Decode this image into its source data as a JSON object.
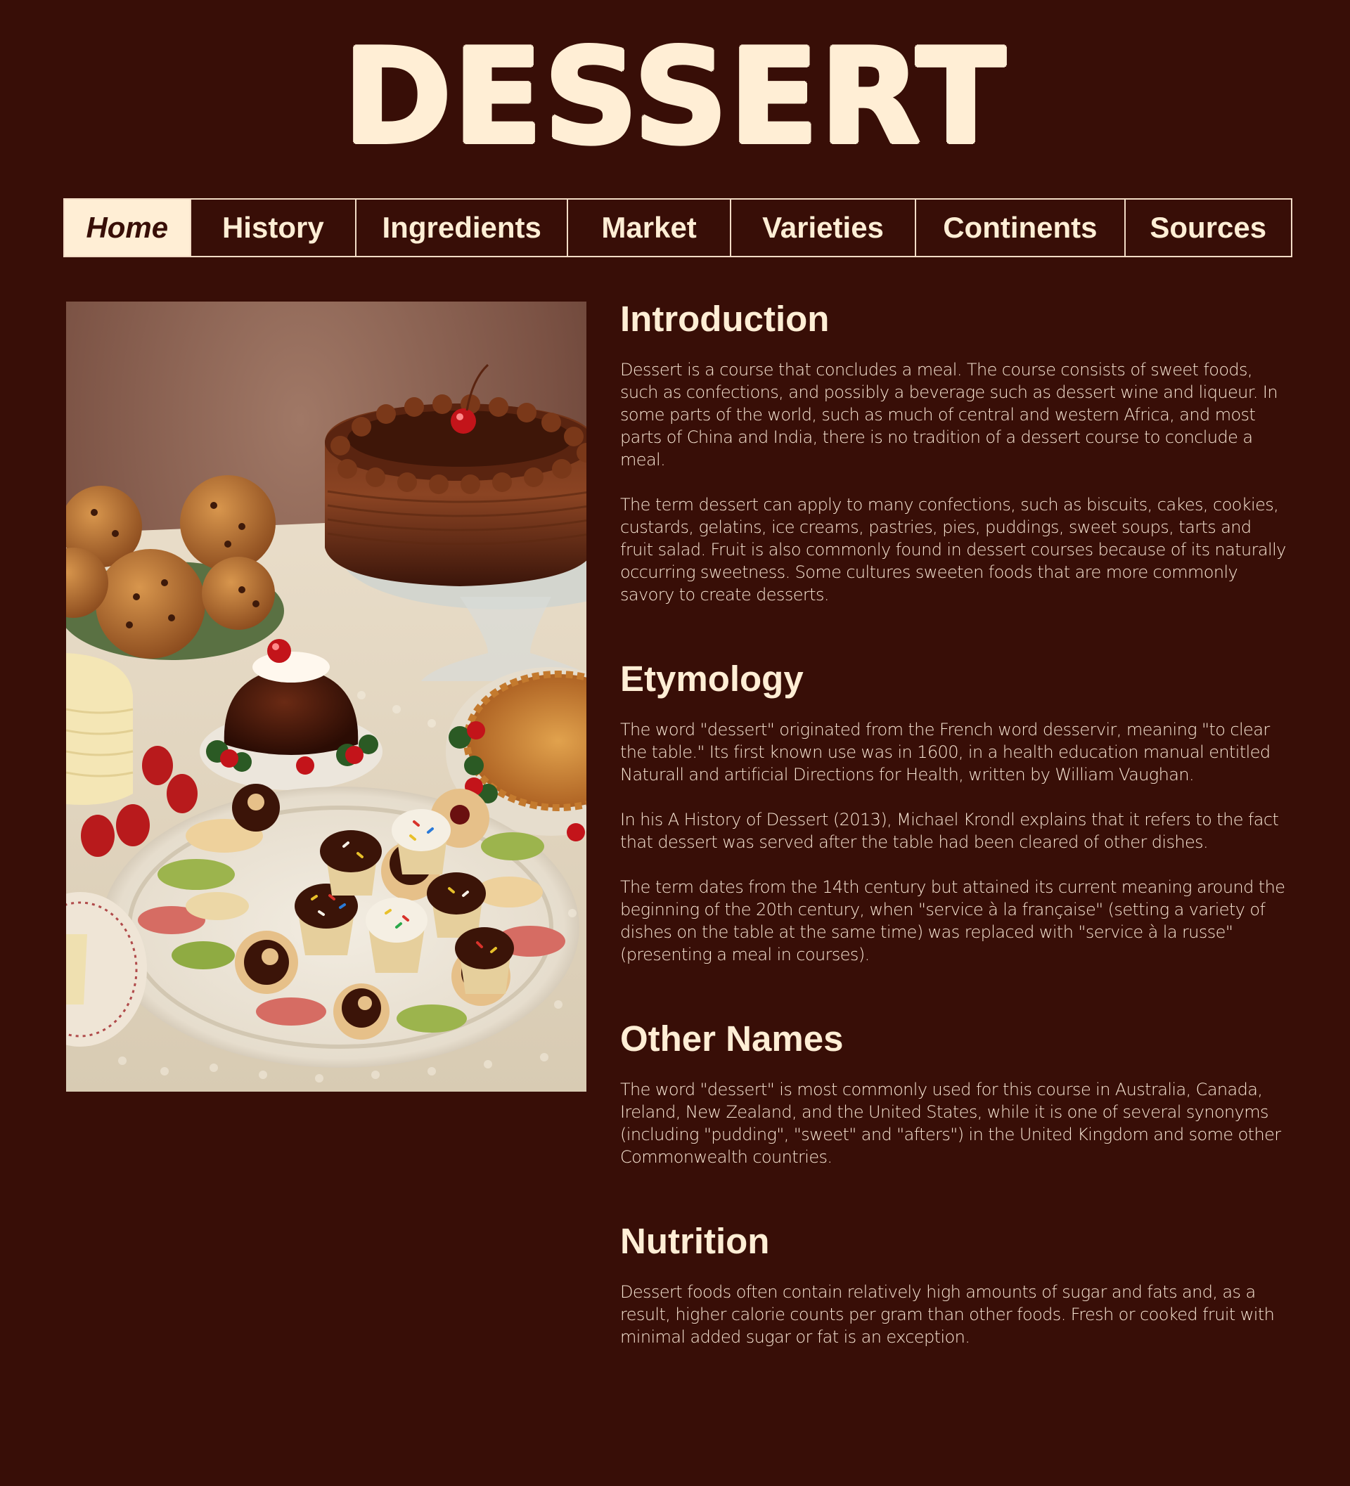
{
  "site_title": "DESSERT",
  "nav": [
    {
      "label": "Home",
      "active": true
    },
    {
      "label": "History"
    },
    {
      "label": "Ingredients"
    },
    {
      "label": "Market"
    },
    {
      "label": "Varieties"
    },
    {
      "label": "Continents"
    },
    {
      "label": "Sources"
    }
  ],
  "sections": [
    {
      "heading": "Introduction",
      "paragraphs": [
        "Dessert is a course that concludes a meal. The course consists of sweet foods, such as confections, and possibly a beverage such as dessert wine and liqueur. In some parts of the world, such as much of central and western Africa, and most parts of China and India, there is no tradition of a dessert course to conclude a meal.",
        "The term dessert can apply to many confections, such as biscuits, cakes, cookies, custards, gelatins, ice creams, pastries, pies, puddings, sweet soups, tarts and fruit salad. Fruit is also commonly found in dessert courses because of its naturally occurring sweetness. Some cultures sweeten foods that are more commonly savory to create desserts."
      ]
    },
    {
      "heading": "Etymology",
      "paragraphs": [
        "The word \"dessert\" originated from the French word desservir, meaning \"to clear the table.\" Its first known use was in 1600, in a health education manual entitled Naturall and artificial Directions for Health, written by William Vaughan.",
        "In his A History of Dessert (2013), Michael Krondl explains that it refers to the fact that dessert was served after the table had been cleared of other dishes.",
        "The term dates from the 14th century but attained its current meaning around the beginning of the 20th century, when \"service à la française\" (setting a variety of dishes on the table at the same time) was replaced with \"service à la russe\" (presenting a meal in courses)."
      ]
    },
    {
      "heading": "Other Names",
      "paragraphs": [
        "The word \"dessert\" is most commonly used for this course in Australia, Canada, Ireland, New Zealand, and the United States, while it is one of several synonyms (including \"pudding\", \"sweet\" and \"afters\") in the United Kingdom and some other Commonwealth countries."
      ]
    },
    {
      "heading": "Nutrition",
      "paragraphs": [
        "Dessert foods often contain relatively high amounts of sugar and fats and, as a result, higher calorie counts per gram than other foods. Fresh or cooked fruit with minimal added sugar or fat is an exception."
      ]
    }
  ],
  "colors": {
    "background": "#380e07",
    "text": "#ffeed5",
    "nav_border": "#f3dcc6"
  }
}
